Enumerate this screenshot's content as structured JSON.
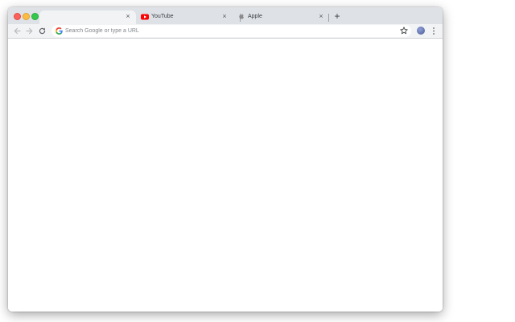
{
  "window": {
    "controls": {
      "close_color": "#fc605c",
      "minimize_color": "#fdbc40",
      "maximize_color": "#34c84a"
    }
  },
  "tabs": [
    {
      "title": "",
      "active": true,
      "favicon": "none"
    },
    {
      "title": "YouTube",
      "active": false,
      "favicon": "youtube-icon",
      "favicon_color": "#ff0000"
    },
    {
      "title": "Apple",
      "active": false,
      "favicon": "apple-icon",
      "favicon_color": "#8a8a8a"
    }
  ],
  "tab_close_glyph": "×",
  "new_tab_glyph": "+",
  "toolbar": {
    "back_icon": "arrow-left-icon",
    "forward_icon": "arrow-right-icon",
    "reload_icon": "reload-icon",
    "omnibox": {
      "placeholder": "Search Google or type a URL",
      "value": "",
      "leading_icon": "google-g-icon",
      "trailing_icon": "star-icon"
    },
    "profile_icon": "avatar",
    "menu_icon": "kebab-menu-icon"
  },
  "colors": {
    "tabstrip_bg": "#dee1e6",
    "toolbar_bg": "#f1f3f4",
    "content_bg": "#ffffff"
  }
}
